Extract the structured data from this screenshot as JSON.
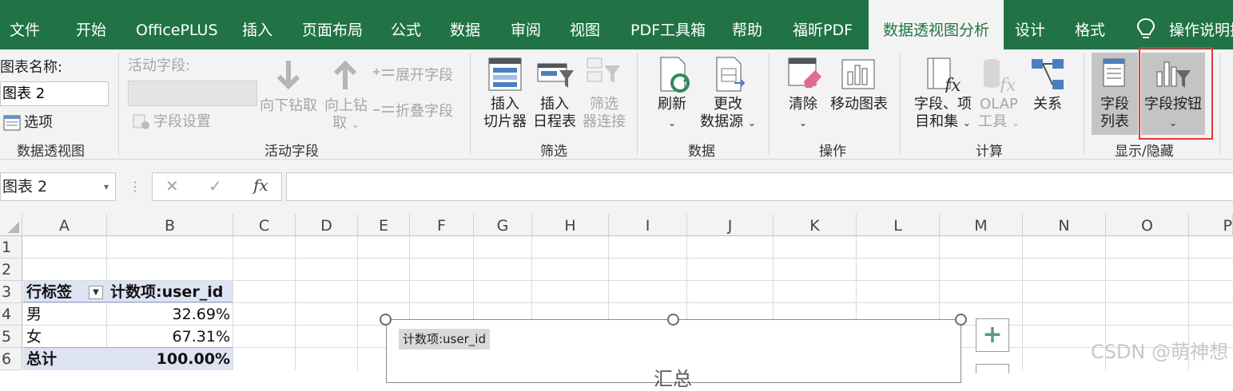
{
  "tabs": [
    "文件",
    "开始",
    "OfficePLUS",
    "插入",
    "页面布局",
    "公式",
    "数据",
    "审阅",
    "视图",
    "PDF工具箱",
    "帮助",
    "福昕PDF",
    "数据透视图分析",
    "设计",
    "格式",
    "操作说明搜"
  ],
  "ribbon": {
    "chart_name_label": "图表名称:",
    "chart_name_value": "图表 2",
    "options": "选项",
    "group_pivot": "数据透视图",
    "active_field_label": "活动字段:",
    "field_settings": "字段设置",
    "drill_down": "向下钻取",
    "drill_up_1": "向上钻",
    "drill_up_2": "取",
    "expand_field": "展开字段",
    "collapse_field": "折叠字段",
    "group_active_field": "活动字段",
    "insert_slicer_1": "插入",
    "insert_slicer_2": "切片器",
    "insert_timeline_1": "插入",
    "insert_timeline_2": "日程表",
    "filter_conn_1": "筛选",
    "filter_conn_2": "器连接",
    "group_filter": "筛选",
    "refresh": "刷新",
    "change_source_1": "更改",
    "change_source_2": "数据源",
    "group_data": "数据",
    "clear": "清除",
    "move_chart": "移动图表",
    "group_actions": "操作",
    "fields_items_1": "字段、项",
    "fields_items_2": "目和集",
    "olap_1": "OLAP",
    "olap_2": "工具",
    "relationships": "关系",
    "group_calc": "计算",
    "field_list_1": "字段",
    "field_list_2": "列表",
    "field_buttons": "字段按钮",
    "group_show": "显示/隐藏"
  },
  "formula_bar": {
    "name_box": "图表 2",
    "cancel": "✕",
    "enter": "✓",
    "fx": "fx",
    "value": ""
  },
  "columns": [
    "A",
    "B",
    "C",
    "D",
    "E",
    "F",
    "G",
    "H",
    "I",
    "J",
    "K",
    "L",
    "M",
    "N",
    "O",
    "P"
  ],
  "rows": [
    "1",
    "2",
    "3",
    "4",
    "5",
    "6"
  ],
  "pivot": {
    "header_row_label": "行标签",
    "header_value": "计数项:user_id",
    "rows": [
      {
        "label": "男",
        "value": "32.69%"
      },
      {
        "label": "女",
        "value": "67.31%"
      }
    ],
    "total_label": "总计",
    "total_value": "100.00%"
  },
  "chart": {
    "field_button": "计数项:user_id",
    "title_partial": "汇总",
    "add_element": "+"
  },
  "watermark": "CSDN @萌神想",
  "colors": {
    "excel_green": "#217346",
    "pivot_header": "#dde3f3",
    "highlight_border": "#e03a3a"
  }
}
